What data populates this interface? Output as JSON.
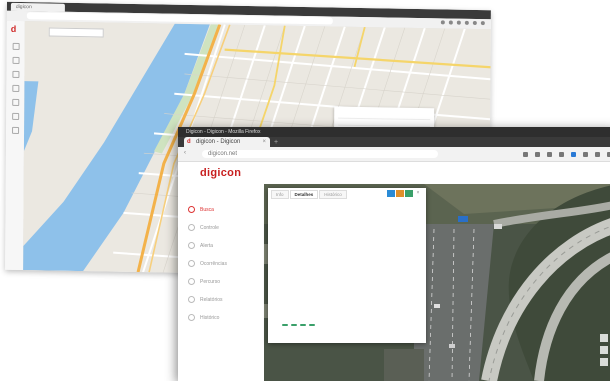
{
  "back_window": {
    "tab_title": "digicon",
    "url": "",
    "search_placeholder": "",
    "popup": {
      "tabs": [
        "",
        "",
        ""
      ],
      "cols": [
        "",
        "",
        ""
      ]
    }
  },
  "front_window": {
    "titlebar": "Digicon - Digicon - Mozilla Firefox",
    "tab_title": "digicon - Digicon",
    "url": "digicon.net",
    "brand": "digicon",
    "sidebar": {
      "caption": "",
      "items": [
        {
          "label": "Busca",
          "active": true
        },
        {
          "label": "Controle",
          "active": false
        },
        {
          "label": "Alerta",
          "active": false
        },
        {
          "label": "Ocorrências",
          "active": false
        },
        {
          "label": "Percurso",
          "active": false
        },
        {
          "label": "Relatórios",
          "active": false
        },
        {
          "label": "Histórico",
          "active": false
        }
      ]
    },
    "popup": {
      "tabs": [
        "Info",
        "Detalhes",
        "Histórico"
      ],
      "title": "",
      "subtitle": "",
      "headers": [
        "",
        "",
        "",
        "",
        ""
      ],
      "rows": [
        [
          "",
          "",
          "",
          "",
          ""
        ],
        [
          "",
          "",
          "",
          "",
          ""
        ],
        [
          "",
          "",
          "",
          "",
          ""
        ]
      ],
      "buttons": [
        "",
        "",
        "",
        ""
      ],
      "footer": ""
    }
  },
  "colors": {
    "brand_red": "#c82020",
    "accent_blue": "#2a8bd6",
    "button_green": "#3aa06a",
    "action_orange": "#e0902a"
  }
}
